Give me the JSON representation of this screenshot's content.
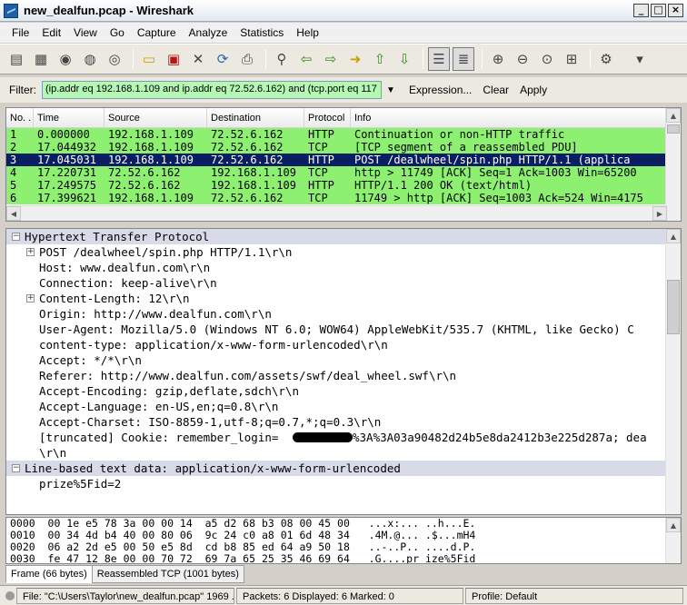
{
  "window": {
    "title": "new_dealfun.pcap - Wireshark"
  },
  "menu": [
    "File",
    "Edit",
    "View",
    "Go",
    "Capture",
    "Analyze",
    "Statistics",
    "Help"
  ],
  "toolbar": {
    "icons": [
      "interface-list-icon",
      "capture-options-icon",
      "start-capture-icon",
      "stop-capture-icon",
      "restart-capture-icon",
      "open-file-icon",
      "save-file-icon",
      "close-file-icon",
      "reload-icon",
      "print-icon",
      "find-icon",
      "go-back-icon",
      "go-forward-icon",
      "go-to-packet-icon",
      "go-first-icon",
      "go-last-icon",
      "colorize-icon",
      "autoscroll-icon",
      "zoom-in-icon",
      "zoom-out-icon",
      "normal-size-icon",
      "resize-columns-icon",
      "capture-filters-icon",
      "more-icon"
    ]
  },
  "filter": {
    "label": "Filter:",
    "value": "(ip.addr eq 192.168.1.109 and ip.addr eq 72.52.6.162) and (tcp.port eq 117",
    "expression": "Expression...",
    "clear": "Clear",
    "apply": "Apply",
    "valid_color": "#b5f7b5"
  },
  "packet_list": {
    "columns": [
      "No. .",
      "Time",
      "Source",
      "Destination",
      "Protocol",
      "Info"
    ],
    "rows": [
      {
        "no": "1",
        "time": "0.000000",
        "src": "192.168.1.109",
        "dst": "72.52.6.162",
        "proto": "HTTP",
        "info": "Continuation or non-HTTP traffic",
        "selected": false
      },
      {
        "no": "2",
        "time": "17.044932",
        "src": "192.168.1.109",
        "dst": "72.52.6.162",
        "proto": "TCP",
        "info": "[TCP segment of a reassembled PDU]",
        "selected": false
      },
      {
        "no": "3",
        "time": "17.045031",
        "src": "192.168.1.109",
        "dst": "72.52.6.162",
        "proto": "HTTP",
        "info": "POST /dealwheel/spin.php HTTP/1.1  (applica",
        "selected": true
      },
      {
        "no": "4",
        "time": "17.220731",
        "src": "72.52.6.162",
        "dst": "192.168.1.109",
        "proto": "TCP",
        "info": "http > 11749 [ACK] Seq=1 Ack=1003 Win=65200",
        "selected": false
      },
      {
        "no": "5",
        "time": "17.249575",
        "src": "72.52.6.162",
        "dst": "192.168.1.109",
        "proto": "HTTP",
        "info": "HTTP/1.1 200 OK  (text/html)",
        "selected": false
      },
      {
        "no": "6",
        "time": "17.399621",
        "src": "192.168.1.109",
        "dst": "72.52.6.162",
        "proto": "TCP",
        "info": "11749 > http [ACK] Seq=1003 Ack=524 Win=4175",
        "selected": false
      }
    ],
    "row_color": "#8df070",
    "selected_color": "#0a1e63"
  },
  "details": {
    "rows": [
      {
        "text": "Hypertext Transfer Protocol",
        "indent": 0,
        "expander": "minus",
        "section": true
      },
      {
        "text": "POST /dealwheel/spin.php HTTP/1.1\\r\\n",
        "indent": 1,
        "expander": "plus",
        "section": false
      },
      {
        "text": "Host: www.dealfun.com\\r\\n",
        "indent": 1,
        "expander": "",
        "section": false
      },
      {
        "text": "Connection: keep-alive\\r\\n",
        "indent": 1,
        "expander": "",
        "section": false
      },
      {
        "text": "Content-Length: 12\\r\\n",
        "indent": 1,
        "expander": "plus",
        "section": false
      },
      {
        "text": "Origin: http://www.dealfun.com\\r\\n",
        "indent": 1,
        "expander": "",
        "section": false
      },
      {
        "text": "User-Agent: Mozilla/5.0 (Windows NT 6.0; WOW64) AppleWebKit/535.7 (KHTML, like Gecko) C",
        "indent": 1,
        "expander": "",
        "section": false
      },
      {
        "text": "content-type: application/x-www-form-urlencoded\\r\\n",
        "indent": 1,
        "expander": "",
        "section": false
      },
      {
        "text": "Accept: */*\\r\\n",
        "indent": 1,
        "expander": "",
        "section": false
      },
      {
        "text": "Referer: http://www.dealfun.com/assets/swf/deal_wheel.swf\\r\\n",
        "indent": 1,
        "expander": "",
        "section": false
      },
      {
        "text": "Accept-Encoding: gzip,deflate,sdch\\r\\n",
        "indent": 1,
        "expander": "",
        "section": false
      },
      {
        "text": "Accept-Language: en-US,en;q=0.8\\r\\n",
        "indent": 1,
        "expander": "",
        "section": false
      },
      {
        "text": "Accept-Charset: ISO-8859-1,utf-8;q=0.7,*;q=0.3\\r\\n",
        "indent": 1,
        "expander": "",
        "section": false
      },
      {
        "text": "[truncated] Cookie: remember_login=",
        "indent": 1,
        "expander": "",
        "section": false,
        "redacted": true,
        "after": "%3A%3A03a90482d24b5e8da2412b3e225d287a; dea"
      },
      {
        "text": "\\r\\n",
        "indent": 1,
        "expander": "",
        "section": false
      },
      {
        "text": "Line-based text data: application/x-www-form-urlencoded",
        "indent": 0,
        "expander": "minus",
        "section": true
      },
      {
        "text": "prize%5Fid=2",
        "indent": 1,
        "expander": "",
        "section": false
      }
    ]
  },
  "hex": {
    "rows": [
      "0000  00 1e e5 78 3a 00 00 14  a5 d2 68 b3 08 00 45 00   ...x:... ..h...E.",
      "0010  00 34 4d b4 40 00 80 06  9c 24 c0 a8 01 6d 48 34   .4M.@... .$...mH4",
      "0020  06 a2 2d e5 00 50 e5 8d  cd b8 85 ed 64 a9 50 18   ..-..P.. ....d.P.",
      "0030  fe 47 12 8e 00 00 70 72  69 7a 65 25 35 46 69 64   .G....pr ize%5Fid"
    ]
  },
  "tabs": [
    "Frame (66 bytes)",
    "Reassembled TCP (1001 bytes)"
  ],
  "status": {
    "file": "File: \"C:\\Users\\Taylor\\new_dealfun.pcap\" 1969 ...",
    "packets": "Packets: 6 Displayed: 6 Marked: 0",
    "profile": "Profile: Default"
  }
}
